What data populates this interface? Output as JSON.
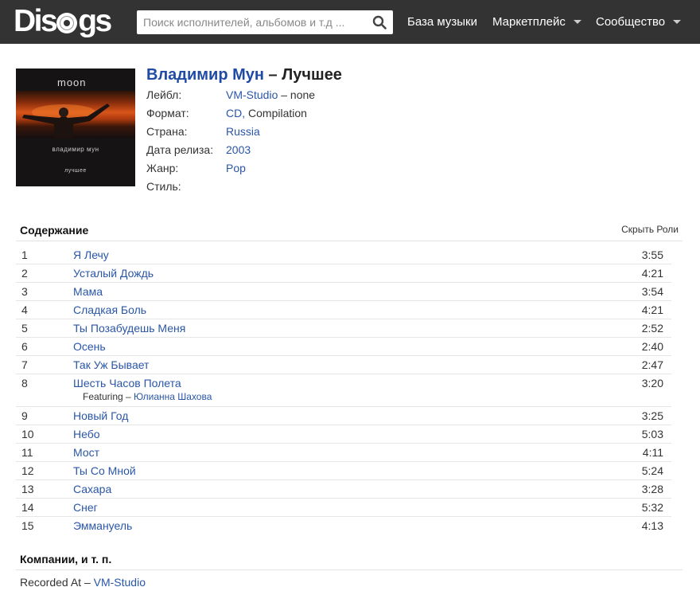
{
  "header": {
    "logo_text_left": "Dis",
    "logo_text_right": "gs",
    "search_placeholder": "Поиск исполнителей, альбомов и т.д ...",
    "nav": [
      {
        "label": "База музыки"
      },
      {
        "label": "Маркетплейс"
      },
      {
        "label": "Сообщество"
      }
    ]
  },
  "cover": {
    "top_text": "moon",
    "artist_text": "владимир мун",
    "title_text": "лучшее"
  },
  "release": {
    "artist": "Владимир Мун",
    "separator": " – ",
    "title": "Лучшее",
    "label_label": "Лейбл:",
    "label_link": "VM-Studio",
    "label_rest": " – none",
    "format_label": "Формат:",
    "format_link": "CD,",
    "format_rest": " Compilation",
    "country_label": "Страна:",
    "country_value": "Russia",
    "released_label": "Дата релиза:",
    "released_value": "2003",
    "genre_label": "Жанр:",
    "genre_value": "Pop",
    "style_label": "Стиль:"
  },
  "tracklist": {
    "heading": "Содержание",
    "toggle_label": "Скрыть Роли",
    "tracks": [
      {
        "pos": "1",
        "title": "Я Лечу",
        "duration": "3:55"
      },
      {
        "pos": "2",
        "title": "Усталый Дождь",
        "duration": "4:21"
      },
      {
        "pos": "3",
        "title": "Мама",
        "duration": "3:54"
      },
      {
        "pos": "4",
        "title": "Сладкая Боль",
        "duration": "4:21"
      },
      {
        "pos": "5",
        "title": "Ты Позабудешь Меня",
        "duration": "2:52"
      },
      {
        "pos": "6",
        "title": "Осень",
        "duration": "2:40"
      },
      {
        "pos": "7",
        "title": "Так Уж Бывает",
        "duration": "2:47"
      },
      {
        "pos": "8",
        "title": "Шесть Часов Полета",
        "duration": "3:20",
        "credit_role": "Featuring – ",
        "credit_name": "Юлианна Шахова"
      },
      {
        "pos": "9",
        "title": "Новый Год",
        "duration": "3:25"
      },
      {
        "pos": "10",
        "title": "Небо",
        "duration": "5:03"
      },
      {
        "pos": "11",
        "title": "Мост",
        "duration": "4:11"
      },
      {
        "pos": "12",
        "title": "Ты Со Мной",
        "duration": "5:24"
      },
      {
        "pos": "13",
        "title": "Сахара",
        "duration": "3:28"
      },
      {
        "pos": "14",
        "title": "Снег",
        "duration": "5:32"
      },
      {
        "pos": "15",
        "title": "Эммануель",
        "duration": "4:13"
      }
    ]
  },
  "companies": {
    "heading": "Компании, и т. п.",
    "items": [
      {
        "role": "Recorded At – ",
        "name": "VM-Studio"
      }
    ]
  }
}
